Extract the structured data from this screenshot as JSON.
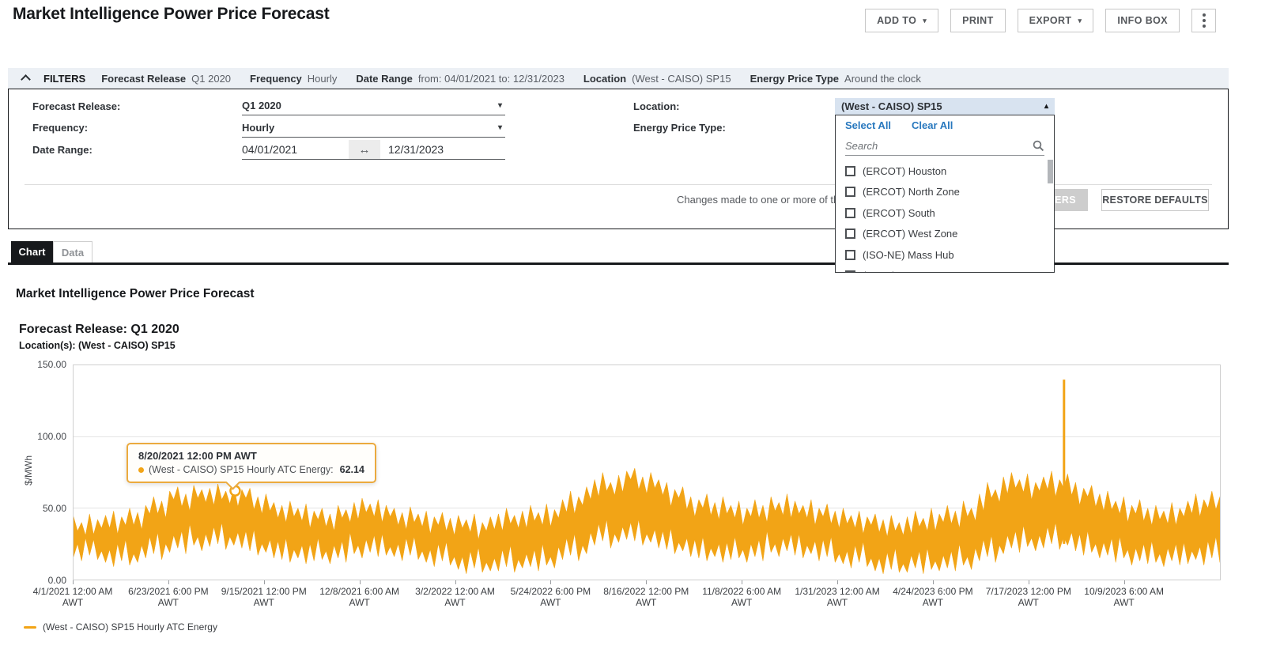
{
  "header": {
    "title": "Market Intelligence Power Price Forecast",
    "buttons": {
      "add_to": "ADD TO",
      "print": "PRINT",
      "export": "EXPORT",
      "info_box": "INFO BOX"
    }
  },
  "icons": {
    "chevron_down": "▾",
    "chevron_up_solid": "▴",
    "double_arrow": "↔"
  },
  "filters_bar": {
    "label": "FILTERS",
    "summary": [
      {
        "label": "Forecast Release",
        "value": "Q1 2020"
      },
      {
        "label": "Frequency",
        "value": "Hourly"
      },
      {
        "label": "Date Range",
        "value": "from: 04/01/2021 to: 12/31/2023"
      },
      {
        "label": "Location",
        "value": "(West - CAISO) SP15"
      },
      {
        "label": "Energy Price Type",
        "value": "Around the clock"
      }
    ]
  },
  "filter_panel": {
    "forecast_release_label": "Forecast Release:",
    "forecast_release_value": "Q1 2020",
    "frequency_label": "Frequency:",
    "frequency_value": "Hourly",
    "date_range_label": "Date Range:",
    "date_from": "04/01/2021",
    "date_to": "12/31/2023",
    "location_label": "Location:",
    "energy_price_type_label": "Energy Price Type:",
    "note_visible_text": "Changes made to one or more of the",
    "apply_button": "APPLY FILTERS",
    "restore_button": "RESTORE DEFAULTS"
  },
  "location_dropdown": {
    "selected_value": "(West - CAISO) SP15",
    "select_all": "Select All",
    "clear_all": "Clear All",
    "search_placeholder": "Search",
    "options": [
      "(ERCOT) Houston",
      "(ERCOT) North Zone",
      "(ERCOT) South",
      "(ERCOT) West Zone",
      "(ISO-NE) Mass Hub",
      "(MISO) ARKANSAS.HUB"
    ]
  },
  "tabs": [
    {
      "label": "Chart",
      "active": true
    },
    {
      "label": "Data",
      "active": false
    }
  ],
  "tooltip": {
    "date": "8/20/2021 12:00 PM AWT",
    "series_label": "(West - CAISO) SP15 Hourly ATC Energy:",
    "value": "62.14"
  },
  "legend": {
    "items": [
      {
        "label": "(West - CAISO) SP15 Hourly ATC Energy",
        "color": "#F2A416"
      }
    ]
  },
  "chart_data": {
    "type": "line",
    "title": "Market Intelligence Power Price Forecast",
    "subtitle1": "Forecast Release: Q1 2020",
    "subtitle2": "Location(s): (West - CAISO) SP15",
    "ylabel": "$/MWh",
    "ylim": [
      0,
      150
    ],
    "yticks": [
      {
        "label": "150.00",
        "value": 150
      },
      {
        "label": "100.00",
        "value": 100
      },
      {
        "label": "50.00",
        "value": 50
      },
      {
        "label": "0.00",
        "value": 0
      }
    ],
    "gridlines": [
      50,
      100
    ],
    "xticks": [
      "4/1/2021 12:00 AM",
      "6/23/2021 6:00 PM",
      "9/15/2021 12:00 PM",
      "12/8/2021 6:00 AM",
      "3/2/2022 12:00 AM",
      "5/24/2022 6:00 PM",
      "8/16/2022 12:00 PM",
      "11/8/2022 6:00 AM",
      "1/31/2023 12:00 AM",
      "4/24/2023 6:00 PM",
      "7/17/2023 12:00 PM",
      "10/9/2023 6:00 AM"
    ],
    "xtick_suffix": "AWT",
    "sampling_note": "hourly series shown; values below are estimated weekly min/max envelope ($/MWh)",
    "series": [
      {
        "name": "(West - CAISO) SP15 Hourly ATC Energy",
        "color": "#F2A416",
        "weekly_envelope_high": [
          44,
          40,
          46,
          42,
          45,
          48,
          44,
          50,
          47,
          52,
          58,
          55,
          62,
          65,
          60,
          66,
          63,
          64,
          67,
          62,
          65,
          63,
          64,
          58,
          60,
          54,
          52,
          55,
          50,
          53,
          48,
          50,
          46,
          52,
          49,
          54,
          57,
          53,
          56,
          52,
          50,
          47,
          51,
          46,
          48,
          44,
          47,
          43,
          45,
          42,
          46,
          40,
          44,
          46,
          50,
          45,
          48,
          52,
          47,
          53,
          49,
          56,
          62,
          58,
          65,
          70,
          75,
          68,
          73,
          76,
          78,
          72,
          75,
          70,
          68,
          63,
          65,
          58,
          56,
          60,
          54,
          58,
          52,
          55,
          50,
          56,
          52,
          58,
          54,
          60,
          55,
          52,
          56,
          50,
          53,
          48,
          50,
          45,
          48,
          44,
          46,
          42,
          45,
          40,
          44,
          48,
          43,
          50,
          46,
          52,
          48,
          55,
          50,
          60,
          68,
          63,
          72,
          75,
          70,
          74,
          68,
          72,
          76,
          70,
          74,
          68,
          64,
          66,
          60,
          62,
          55,
          58,
          52,
          56,
          50,
          52,
          48,
          54,
          50,
          55,
          60,
          56,
          62,
          58
        ],
        "weekly_envelope_low": [
          16,
          13,
          17,
          14,
          12,
          9,
          13,
          10,
          12,
          15,
          18,
          14,
          19,
          22,
          18,
          24,
          20,
          23,
          25,
          21,
          24,
          22,
          20,
          17,
          19,
          15,
          14,
          12,
          15,
          11,
          13,
          14,
          11,
          15,
          12,
          18,
          15,
          19,
          16,
          17,
          16,
          13,
          17,
          14,
          12,
          9,
          13,
          10,
          7,
          4,
          8,
          5,
          6,
          6,
          9,
          5,
          8,
          9,
          6,
          10,
          8,
          14,
          17,
          13,
          18,
          24,
          27,
          22,
          26,
          28,
          27,
          24,
          26,
          22,
          21,
          18,
          20,
          16,
          15,
          13,
          16,
          12,
          14,
          15,
          12,
          16,
          13,
          19,
          16,
          20,
          17,
          15,
          18,
          13,
          16,
          12,
          11,
          8,
          12,
          9,
          6,
          4,
          7,
          5,
          5,
          8,
          4,
          7,
          6,
          8,
          6,
          10,
          7,
          13,
          16,
          12,
          18,
          22,
          19,
          23,
          20,
          22,
          25,
          21,
          24,
          20,
          17,
          19,
          15,
          17,
          12,
          15,
          10,
          13,
          11,
          12,
          9,
          13,
          10,
          11,
          14,
          10,
          15,
          12
        ]
      }
    ],
    "spike": {
      "x_frac": 0.864,
      "value": 140
    },
    "highlighted_point": {
      "x_frac": 0.141,
      "value": 62.14,
      "date": "8/20/2021 12:00 PM AWT"
    }
  }
}
